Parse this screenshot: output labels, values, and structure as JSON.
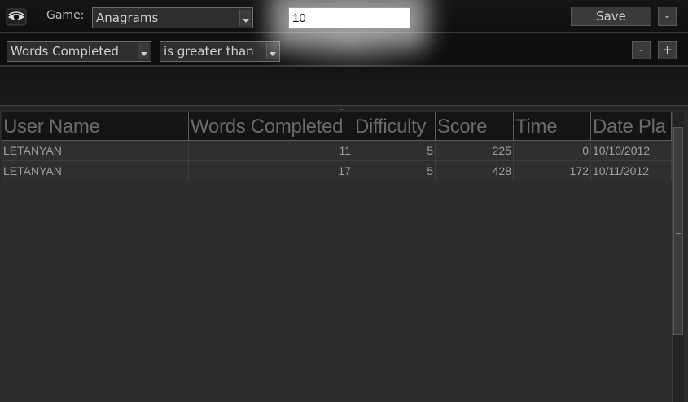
{
  "toolbar": {
    "game_label": "Game:",
    "game_value": "Anagrams",
    "save_label": "Save",
    "minus_label": "-"
  },
  "filter": {
    "field_value": "Words Completed",
    "operator_value": "is greater than",
    "value": "10",
    "remove_label": "-",
    "add_label": "+"
  },
  "grid": {
    "columns": [
      "User Name",
      "Words Completed",
      "Difficulty",
      "Score",
      "Time",
      "Date Pla"
    ],
    "rows": [
      [
        "LETANYAN",
        "11",
        "5",
        "225",
        "0",
        "10/10/2012"
      ],
      [
        "LETANYAN",
        "17",
        "5",
        "428",
        "172",
        "10/11/2012"
      ]
    ]
  }
}
